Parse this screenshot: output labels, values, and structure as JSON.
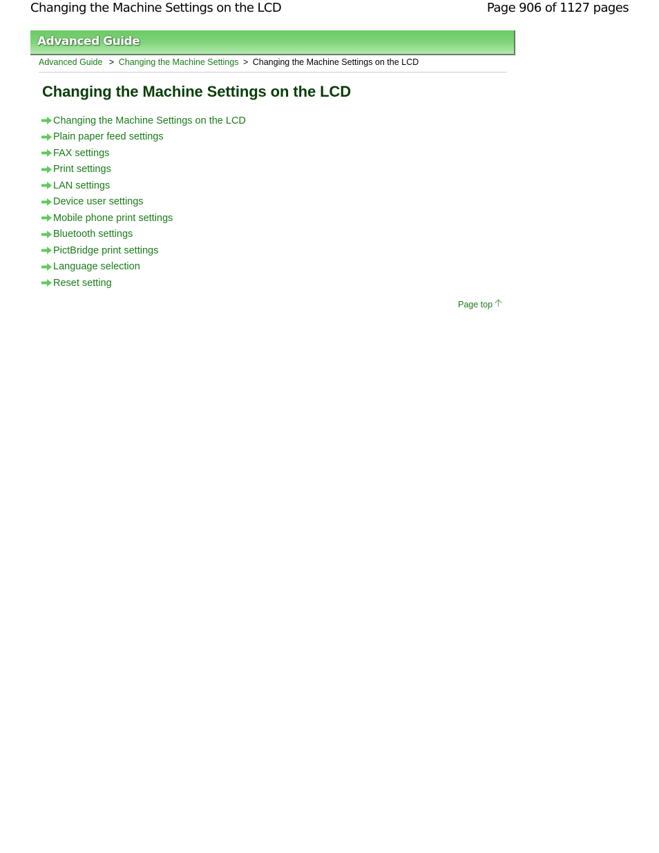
{
  "doc_header": {
    "title": "Changing the Machine Settings on the LCD",
    "page_indicator": "Page 906 of 1127 pages"
  },
  "banner": {
    "title": "Advanced Guide"
  },
  "breadcrumb": {
    "items": [
      {
        "label": "Advanced Guide",
        "link": true
      },
      {
        "label": "Changing the Machine Settings",
        "link": true
      },
      {
        "label": "Changing the Machine Settings on the LCD",
        "link": false
      }
    ],
    "separator": ">"
  },
  "page_title": "Changing the Machine Settings on the LCD",
  "links": [
    {
      "label": "Changing the Machine Settings on the LCD",
      "icon": "green-arrow-right-icon"
    },
    {
      "label": "Plain paper feed settings",
      "icon": "green-arrow-right-icon"
    },
    {
      "label": "FAX settings",
      "icon": "green-arrow-right-icon"
    },
    {
      "label": "Print settings",
      "icon": "green-arrow-right-icon"
    },
    {
      "label": "LAN settings",
      "icon": "green-arrow-right-icon"
    },
    {
      "label": "Device user settings",
      "icon": "green-arrow-right-icon"
    },
    {
      "label": "Mobile phone print settings",
      "icon": "green-arrow-right-icon"
    },
    {
      "label": "Bluetooth settings",
      "icon": "green-arrow-right-icon"
    },
    {
      "label": "PictBridge print settings",
      "icon": "green-arrow-right-icon"
    },
    {
      "label": "Language selection",
      "icon": "green-arrow-right-icon"
    },
    {
      "label": "Reset setting",
      "icon": "green-arrow-right-icon"
    }
  ],
  "page_top": {
    "label": "Page top",
    "icon": "arrow-up-icon"
  },
  "colors": {
    "link": "#1a7b1a",
    "heading": "#0a3d0a",
    "banner": "#7fd379",
    "arrow": "#5fcc5a"
  }
}
